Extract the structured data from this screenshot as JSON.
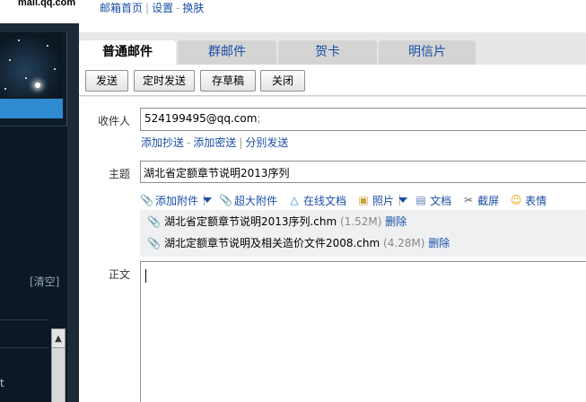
{
  "header": {
    "logo_text": "mail.qq.com",
    "links": [
      "邮箱首页",
      "设置",
      "换肤"
    ]
  },
  "sidebar": {
    "clear_label": "[清空]",
    "partial_char": "t"
  },
  "tabs": [
    {
      "label": "普通邮件",
      "active": true
    },
    {
      "label": "群邮件",
      "active": false
    },
    {
      "label": "贺卡",
      "active": false
    },
    {
      "label": "明信片",
      "active": false
    }
  ],
  "toolbar": {
    "send": "发送",
    "scheduled_send": "定时发送",
    "save_draft": "存草稿",
    "close": "关闭"
  },
  "compose": {
    "to_label": "收件人",
    "to_value": "524199495@qq.com",
    "to_suffix": ";",
    "add_cc": "添加抄送",
    "add_bcc": "添加密送",
    "separate_send": "分别发送",
    "subject_label": "主题",
    "subject_value": "湖北省定额章节说明2013序列",
    "body_label": "正文"
  },
  "attach_toolbar": {
    "add_attachment": "添加附件",
    "large_attachment": "超大附件",
    "online_doc": "在线文档",
    "photo": "照片",
    "document": "文档",
    "screenshot": "截屏",
    "emoji": "表情"
  },
  "attachments": [
    {
      "name": "湖北省定额章节说明2013序列.chm",
      "size": "(1.52M)",
      "delete": "删除"
    },
    {
      "name": "湖北定额章节说明及相关造价文件2008.chm",
      "size": "(4.28M)",
      "delete": "删除"
    }
  ],
  "colors": {
    "link": "#1a4ea5",
    "sidebar_bg": "#0e1c27",
    "accent_bar": "#2f8bd0",
    "main_bg": "#e7e7e7"
  }
}
